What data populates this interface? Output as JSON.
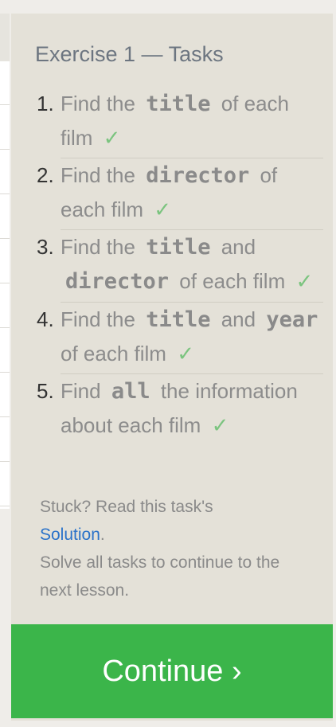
{
  "exercise": {
    "title": "Exercise 1 — Tasks"
  },
  "tasks": [
    {
      "number": "1.",
      "before": "Find the",
      "code": "title",
      "after": "of each film",
      "check": "✓"
    },
    {
      "number": "2.",
      "before": "Find the",
      "code": "director",
      "after": "of each film",
      "check": "✓"
    },
    {
      "number": "3.",
      "before": "Find the",
      "code": "title",
      "mid": "and",
      "code2": "director",
      "after": "of each film",
      "check": "✓"
    },
    {
      "number": "4.",
      "before": "Find the",
      "code": "title",
      "mid": "and",
      "code2": "year",
      "after": "of each film",
      "check": "✓"
    },
    {
      "number": "5.",
      "before": "Find",
      "code": "all",
      "after": "the information about each film",
      "check": "✓"
    }
  ],
  "notes": {
    "stuck": "Stuck? Read this task's",
    "solution_link": "Solution",
    "period": ".",
    "solve_all": "Solve all tasks to continue to the next lesson."
  },
  "continue_button": {
    "label": "Continue ›"
  },
  "colors": {
    "panel_bg": "#e4e1d8",
    "continue_bg": "#3bb54a",
    "check_green": "#7bc47f",
    "link_blue": "#2a72c9"
  }
}
